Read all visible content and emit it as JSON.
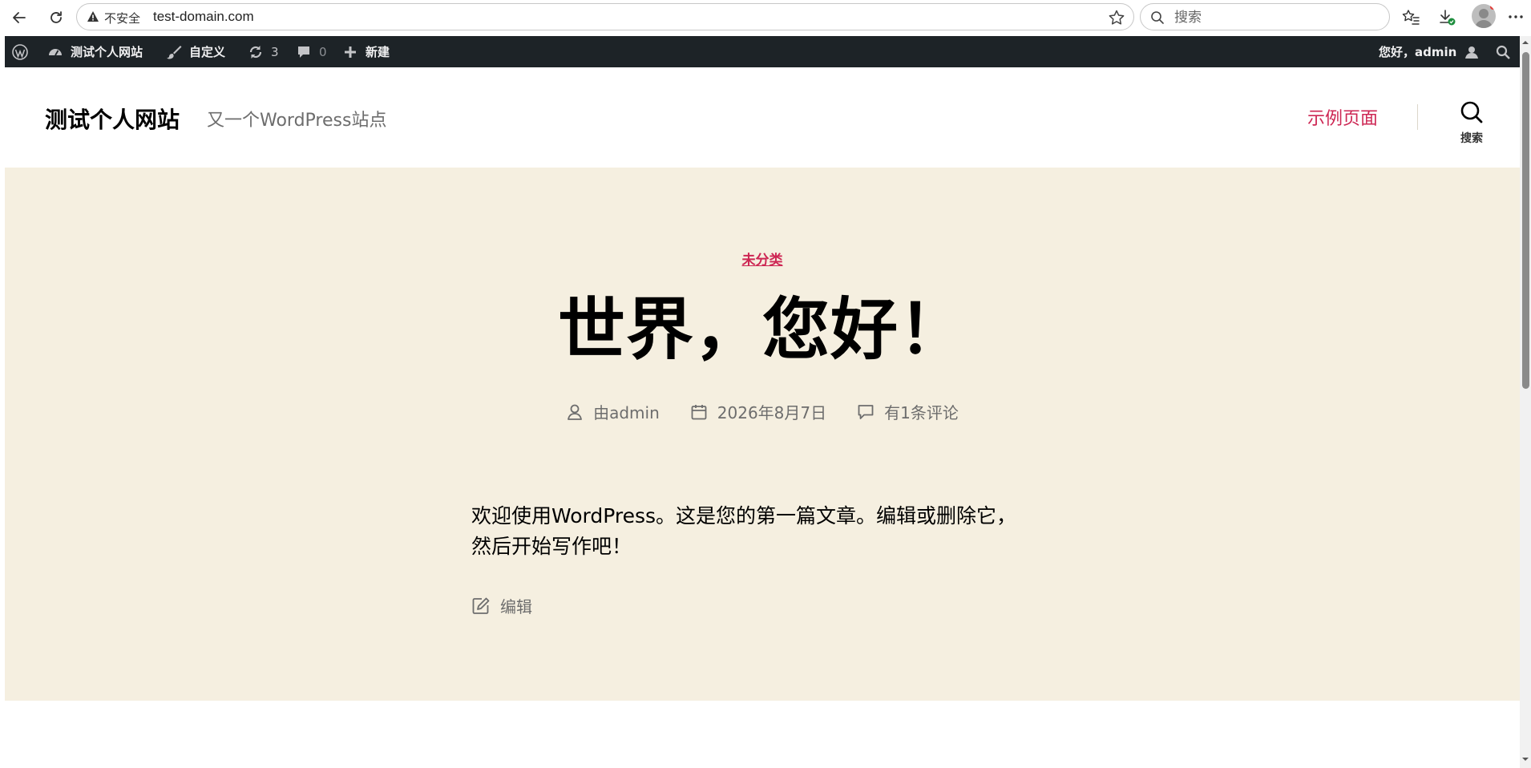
{
  "browser": {
    "security_label": "不安全",
    "url": "test-domain.com",
    "search_placeholder": "搜索"
  },
  "admin_bar": {
    "site_name": "测试个人网站",
    "customize": "自定义",
    "updates_count": "3",
    "comments_count": "0",
    "new": "新建",
    "greeting": "您好，admin"
  },
  "header": {
    "site_title": "测试个人网站",
    "site_description": "又一个WordPress站点",
    "menu_item": "示例页面",
    "search_label": "搜索"
  },
  "post": {
    "category": "未分类",
    "title": "世界，您好！",
    "author": "由admin",
    "date": "2026年8月7日",
    "comments": "有1条评论",
    "content_line1": "欢迎使用WordPress。这是您的第一篇文章。编辑或删除它，",
    "content_line2": "然后开始写作吧！",
    "edit": "编辑"
  },
  "colors": {
    "accent": "#cd2653",
    "admin_bar_bg": "#1d2327",
    "hero_bg": "#f5efe0",
    "meta_text": "#6d6d6d"
  }
}
